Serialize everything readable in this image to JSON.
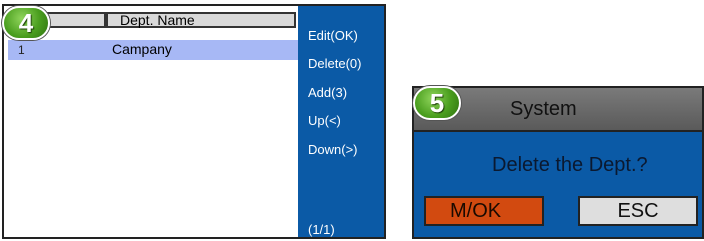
{
  "step_badges": {
    "left": "4",
    "right": "5"
  },
  "dept_list": {
    "columns": {
      "number": "",
      "name": "Dept. Name"
    },
    "rows": [
      {
        "number": "1",
        "name": "Campany",
        "selected": true
      }
    ],
    "row_highlight_color": "#a7b8f5"
  },
  "side_menu": {
    "background_color": "#0b5aa6",
    "items": [
      {
        "label": "Edit(OK)"
      },
      {
        "label": "Delete(0)"
      },
      {
        "label": "Add(3)"
      },
      {
        "label": "Up(<)"
      },
      {
        "label": "Down(>)"
      }
    ],
    "page_indicator": "(1/1)"
  },
  "dialog": {
    "title": "System",
    "message": "Delete the Dept.?",
    "ok_label": "M/OK",
    "esc_label": "ESC",
    "ok_color": "#d24a10",
    "esc_color": "#dedede"
  }
}
